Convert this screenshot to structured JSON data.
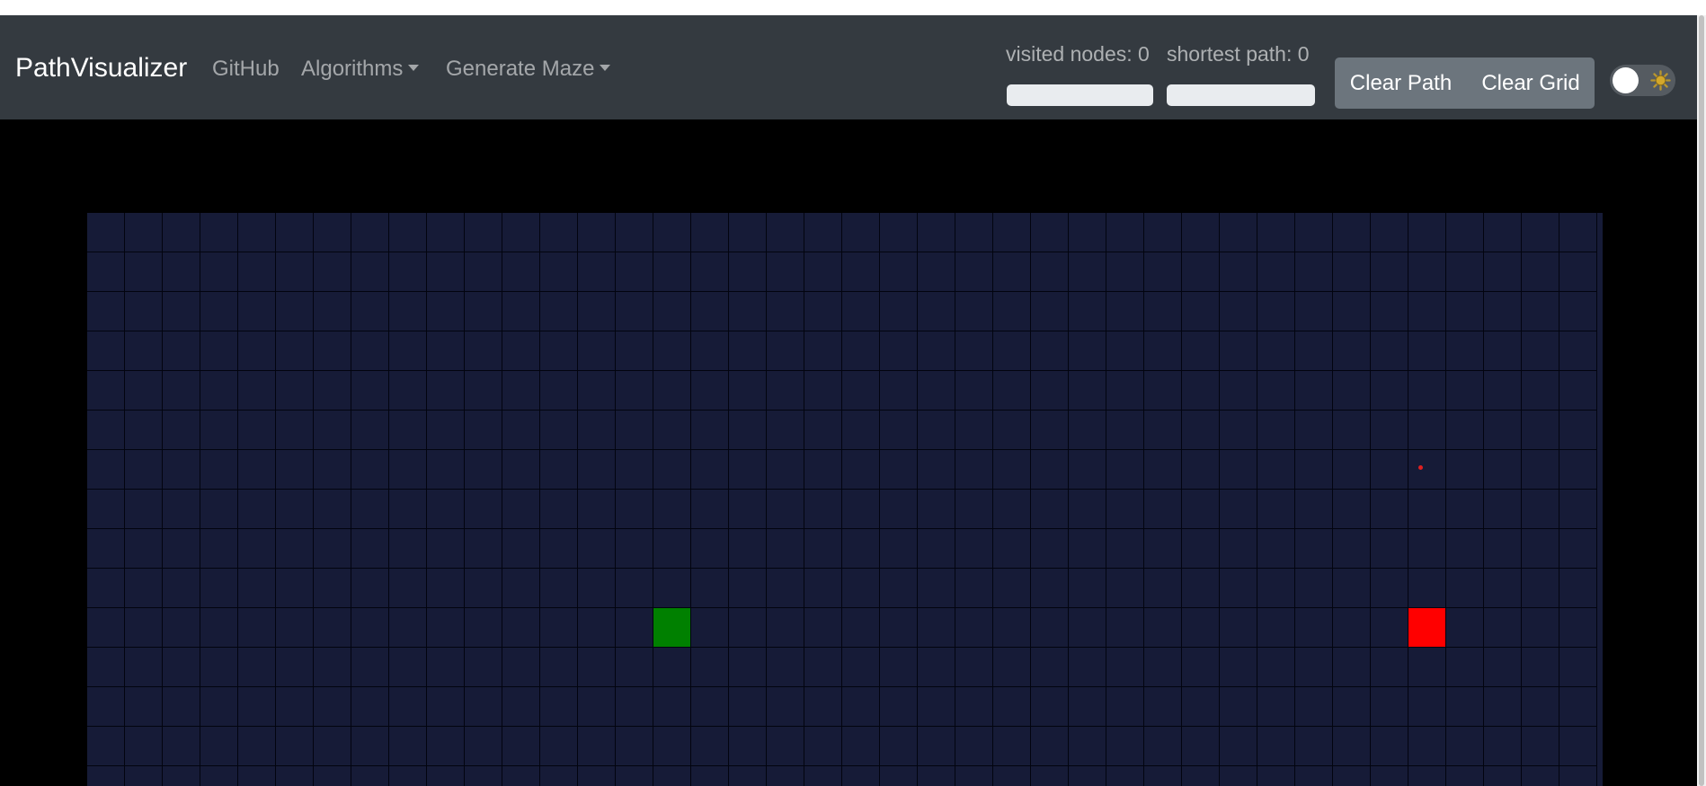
{
  "colors": {
    "navbar": "#343a40",
    "grid_cell": "#161b37",
    "grid_line": "#02040f",
    "start": "#008000",
    "target": "#ff0000",
    "button": "#6c757d"
  },
  "navbar": {
    "brand": "PathVisualizer",
    "links": {
      "github": "GitHub",
      "algorithms": "Algorithms",
      "generate_maze": "Generate Maze"
    }
  },
  "stats": {
    "visited_label": "visited nodes: ",
    "visited_value": "0",
    "visited_progress": 0,
    "shortest_label": "shortest path: ",
    "shortest_value": "0",
    "shortest_progress": 0
  },
  "buttons": {
    "clear_path": "Clear Path",
    "clear_grid": "Clear Grid"
  },
  "theme_toggle": {
    "state": "off",
    "icon": "sun-icon"
  },
  "grid": {
    "columns": 40,
    "visible_rows": 15,
    "start_node": {
      "row": 10,
      "col": 15
    },
    "target_node": {
      "row": 10,
      "col": 35
    }
  }
}
